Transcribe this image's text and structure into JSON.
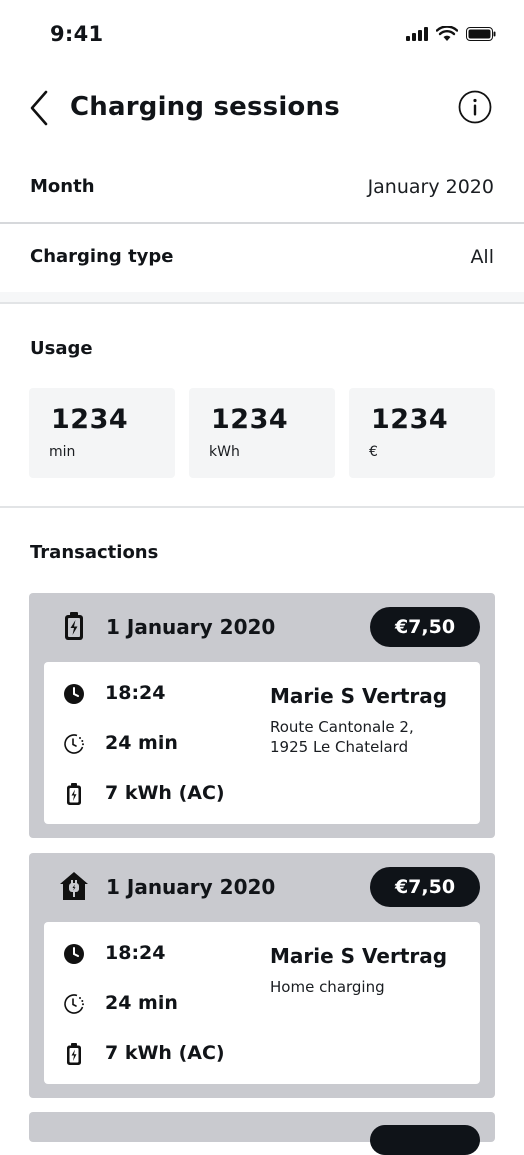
{
  "status_bar": {
    "time": "9:41"
  },
  "header": {
    "title": "Charging sessions"
  },
  "filters": {
    "month": {
      "label": "Month",
      "value": "January 2020"
    },
    "charging_type": {
      "label": "Charging type",
      "value": "All"
    }
  },
  "usage": {
    "title": "Usage",
    "boxes": [
      {
        "value": "1234",
        "unit": "min"
      },
      {
        "value": "1234",
        "unit": "kWh"
      },
      {
        "value": "1234",
        "unit": "€"
      }
    ]
  },
  "transactions": {
    "title": "Transactions",
    "items": [
      {
        "icon": "battery-charging-icon",
        "date": "1 January 2020",
        "price": "€7,50",
        "time": "18:24",
        "duration": "24 min",
        "energy": "7 kWh (AC)",
        "station": "Marie S Vertrag",
        "address_line1": "Route Cantonale 2,",
        "address_line2": "1925 Le Chatelard"
      },
      {
        "icon": "home-charging-icon",
        "date": "1 January 2020",
        "price": "€7,50",
        "time": "18:24",
        "duration": "24 min",
        "energy": "7 kWh (AC)",
        "station": "Marie S Vertrag",
        "address_line1": "Home charging",
        "address_line2": ""
      }
    ]
  }
}
